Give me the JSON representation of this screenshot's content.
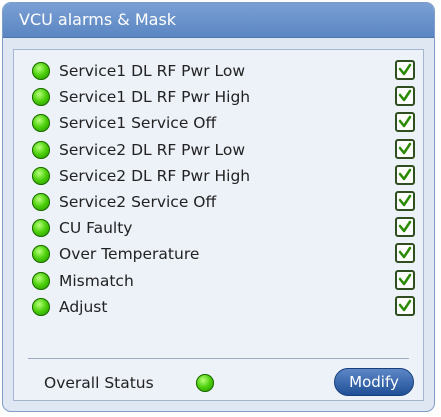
{
  "panel": {
    "title": "VCU alarms & Mask",
    "alarms": [
      {
        "label": "Service1 DL RF Pwr Low",
        "status_color": "#2fb200",
        "masked": true
      },
      {
        "label": "Service1 DL RF Pwr High",
        "status_color": "#2fb200",
        "masked": true
      },
      {
        "label": "Service1 Service Off",
        "status_color": "#2fb200",
        "masked": true
      },
      {
        "label": "Service2 DL RF Pwr Low",
        "status_color": "#2fb200",
        "masked": true
      },
      {
        "label": "Service2 DL RF Pwr High",
        "status_color": "#2fb200",
        "masked": true
      },
      {
        "label": "Service2 Service Off",
        "status_color": "#2fb200",
        "masked": true
      },
      {
        "label": "CU Faulty",
        "status_color": "#2fb200",
        "masked": true
      },
      {
        "label": "Over Temperature",
        "status_color": "#2fb200",
        "masked": true
      },
      {
        "label": "Mismatch",
        "status_color": "#2fb200",
        "masked": true
      },
      {
        "label": "Adjust",
        "status_color": "#2fb200",
        "masked": true
      }
    ],
    "footer": {
      "overall_label": "Overall Status",
      "overall_status_color": "#2fb200",
      "modify_label": "Modify"
    }
  }
}
